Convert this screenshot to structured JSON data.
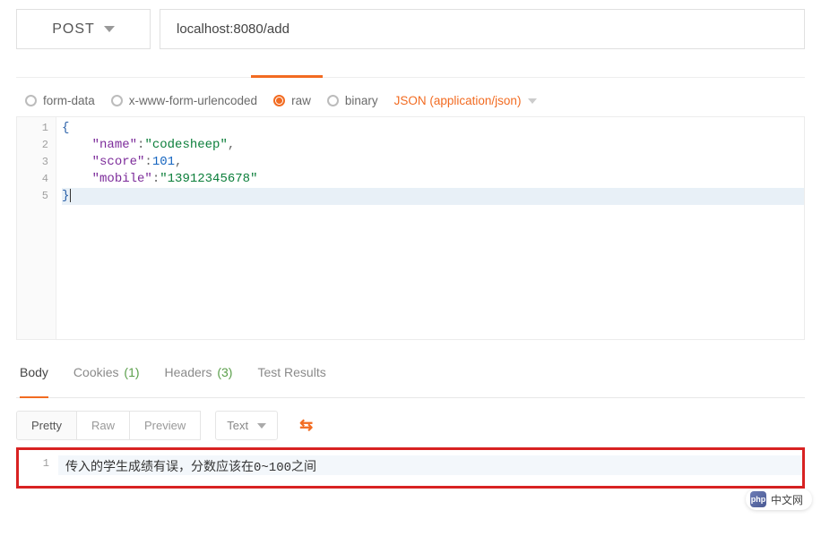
{
  "request": {
    "method": "POST",
    "url": "localhost:8080/add"
  },
  "body_types": [
    {
      "key": "form-data",
      "label": "form-data",
      "selected": false
    },
    {
      "key": "x-www-form-urlencoded",
      "label": "x-www-form-urlencoded",
      "selected": false
    },
    {
      "key": "raw",
      "label": "raw",
      "selected": true
    },
    {
      "key": "binary",
      "label": "binary",
      "selected": false
    }
  ],
  "content_type_label": "JSON (application/json)",
  "editor": {
    "line_numbers": [
      "1",
      "2",
      "3",
      "4",
      "5"
    ],
    "payload": {
      "name": "codesheep",
      "score": 101,
      "mobile": "13912345678"
    }
  },
  "response_tabs": {
    "body": "Body",
    "cookies_label": "Cookies",
    "cookies_count": "(1)",
    "headers_label": "Headers",
    "headers_count": "(3)",
    "test_results": "Test Results"
  },
  "view": {
    "pretty": "Pretty",
    "raw": "Raw",
    "preview": "Preview",
    "format": "Text"
  },
  "response_body": {
    "line_no": "1",
    "text": "传入的学生成绩有误，分数应该在0~100之间"
  },
  "watermark": "中文网"
}
